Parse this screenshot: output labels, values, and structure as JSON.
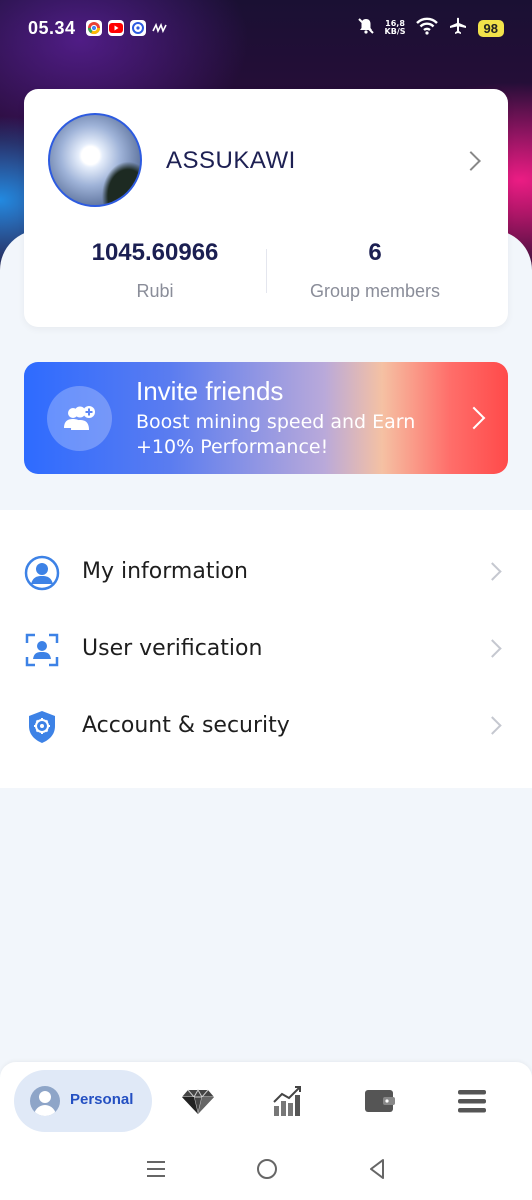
{
  "status_bar": {
    "time": "05.34",
    "net_speed_value": "16,8",
    "net_speed_unit": "KB/S",
    "battery": "98"
  },
  "profile": {
    "username": "ASSUKAWI",
    "stats": [
      {
        "value": "1045.60966",
        "label": "Rubi"
      },
      {
        "value": "6",
        "label": "Group members"
      }
    ]
  },
  "invite": {
    "title": "Invite friends",
    "subtitle": "Boost mining speed and Earn +10% Performance!"
  },
  "menu": {
    "items": [
      {
        "label": "My information",
        "icon": "user-circle-icon"
      },
      {
        "label": "User verification",
        "icon": "face-scan-icon"
      },
      {
        "label": "Account & security",
        "icon": "shield-gear-icon"
      }
    ]
  },
  "bottom_nav": {
    "active_label": "Personal",
    "tabs": [
      "personal-icon",
      "diamond-icon",
      "chart-icon",
      "wallet-icon",
      "menu-icon"
    ]
  },
  "colors": {
    "accent": "#2d5be0",
    "title_text": "#1b1f52",
    "invite_start": "#2e6bff",
    "invite_end": "#ff4a4a"
  }
}
